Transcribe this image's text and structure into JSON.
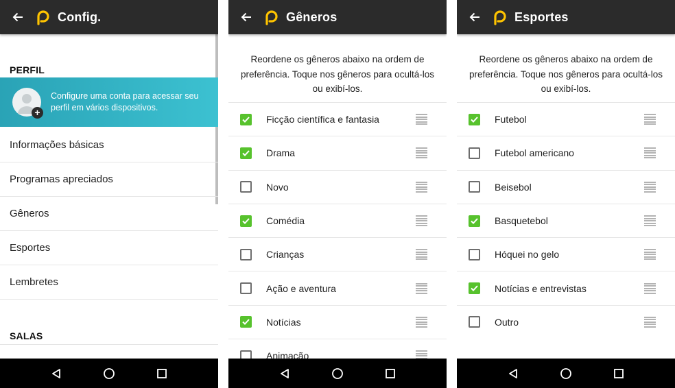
{
  "colors": {
    "appbar": "#2b2b2b",
    "accent": "#ffc400",
    "banner": "#34b3c4",
    "check": "#57c22d"
  },
  "screen1": {
    "title": "Config.",
    "section_profile": "PERFIL",
    "banner_text": "Configure uma conta para acessar seu perfil em vários dispositivos.",
    "menu": [
      "Informações básicas",
      "Programas apreciados",
      "Gêneros",
      "Esportes",
      "Lembretes"
    ],
    "section_rooms": "SALAS"
  },
  "screen2": {
    "title": "Gêneros",
    "intro": "Reordene os gêneros abaixo na ordem de preferência. Toque nos gêneros para ocultá-los ou exibí-los.",
    "items": [
      {
        "label": "Ficção científica e fantasia",
        "checked": true
      },
      {
        "label": "Drama",
        "checked": true
      },
      {
        "label": "Novo",
        "checked": false
      },
      {
        "label": "Comédia",
        "checked": true
      },
      {
        "label": "Crianças",
        "checked": false
      },
      {
        "label": "Ação e aventura",
        "checked": false
      },
      {
        "label": "Notícias",
        "checked": true
      },
      {
        "label": "Animação",
        "checked": false
      }
    ]
  },
  "screen3": {
    "title": "Esportes",
    "intro": "Reordene os gêneros abaixo na ordem de preferência. Toque nos gêneros para ocultá-los ou exibí-los.",
    "items": [
      {
        "label": "Futebol",
        "checked": true
      },
      {
        "label": "Futebol americano",
        "checked": false
      },
      {
        "label": "Beisebol",
        "checked": false
      },
      {
        "label": "Basquetebol",
        "checked": true
      },
      {
        "label": "Hóquei no gelo",
        "checked": false
      },
      {
        "label": "Notícias e entrevistas",
        "checked": true
      },
      {
        "label": "Outro",
        "checked": false
      }
    ]
  },
  "icons": {
    "back": "arrow-left-icon",
    "logo": "p-logo-icon",
    "nav": [
      "back-triangle-icon",
      "home-circle-icon",
      "recents-square-icon"
    ]
  }
}
